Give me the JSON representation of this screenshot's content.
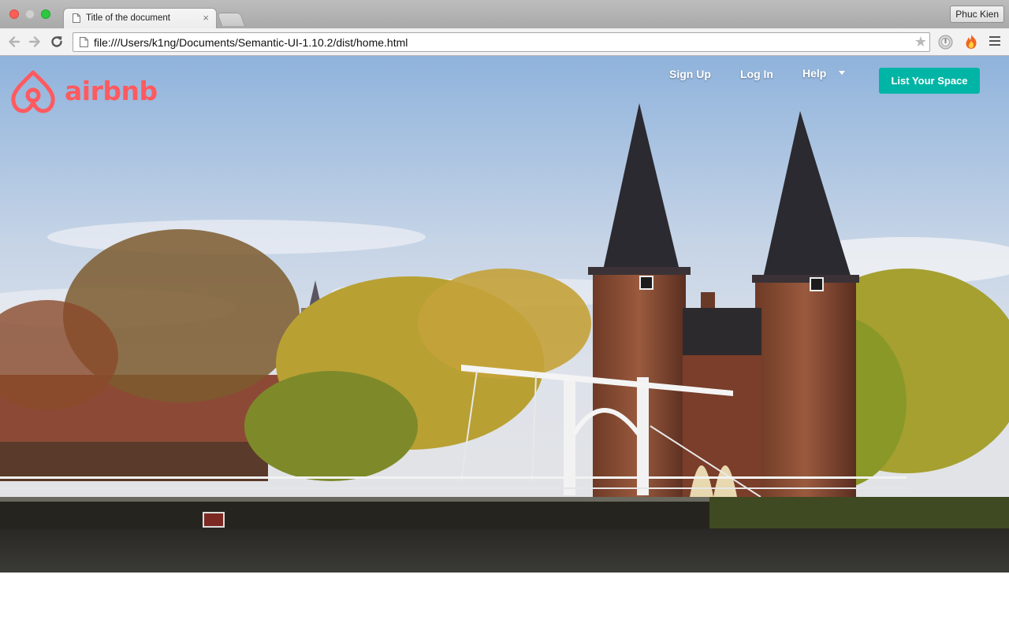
{
  "browser": {
    "tab_title": "Title of the document",
    "tab_close": "×",
    "profile_name": "Phuc Kien",
    "url": "file:///Users/k1ng/Documents/Semantic-UI-1.10.2/dist/home.html",
    "bookmark_glyph": "★",
    "icons": [
      "back-icon",
      "forward-icon",
      "reload-icon",
      "page-icon",
      "star-icon",
      "extension-icon",
      "fire-extension-icon",
      "menu-icon"
    ]
  },
  "site": {
    "logo_text": "airbnb",
    "nav": {
      "signup": "Sign Up",
      "login": "Log In",
      "help": "Help"
    },
    "cta": "List Your Space",
    "colors": {
      "brand": "#ff5a5f",
      "cta": "#00b5a5",
      "nav_text": "#ffffff"
    }
  }
}
